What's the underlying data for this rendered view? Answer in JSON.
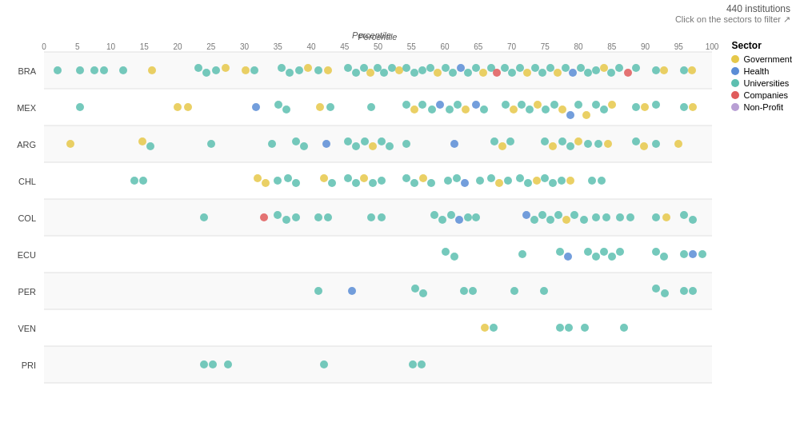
{
  "header": {
    "institutions_count": "440 institutions",
    "click_info": "Click on the sectors to filter ↗"
  },
  "x_axis": {
    "label": "Percentile",
    "ticks": [
      "0",
      "5",
      "10",
      "15",
      "20",
      "25",
      "30",
      "35",
      "40",
      "45",
      "50",
      "55",
      "60",
      "65",
      "70",
      "75",
      "80",
      "85",
      "90",
      "95",
      "100"
    ]
  },
  "y_axis": {
    "rows": [
      "BRA",
      "MEX",
      "ARG",
      "CHL",
      "COL",
      "ECU",
      "PER",
      "VEN",
      "PRI"
    ]
  },
  "legend": {
    "title": "Sector",
    "items": [
      {
        "label": "Government",
        "color": "#e6c84a"
      },
      {
        "label": "Health",
        "color": "#5b8dd6"
      },
      {
        "label": "Universities",
        "color": "#5dbfb0"
      },
      {
        "label": "Companies",
        "color": "#e05c5c"
      },
      {
        "label": "Non-Profit",
        "color": "#b89fd4"
      }
    ]
  },
  "colors": {
    "government": "#e6c84a",
    "health": "#5b8dd6",
    "universities": "#5dbfb0",
    "companies": "#e05c5c",
    "nonprofit": "#b89fd4",
    "row_bg": "#f7f7f7"
  }
}
